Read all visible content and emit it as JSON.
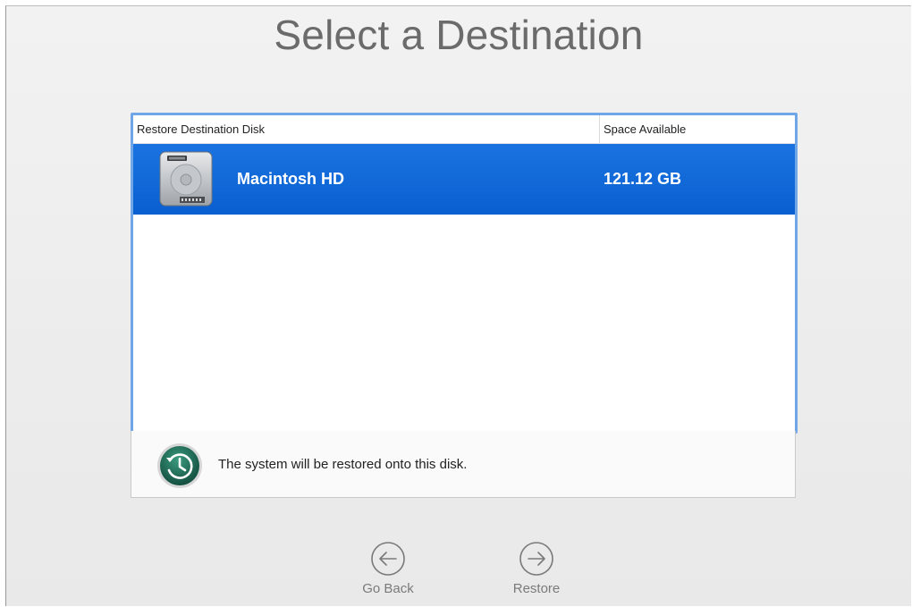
{
  "title": "Select a Destination",
  "table": {
    "columns": [
      "Restore Destination Disk",
      "Space Available"
    ],
    "rows": [
      {
        "name": "Macintosh HD",
        "space": "121.12 GB",
        "icon": "hard-disk-icon",
        "selected": true
      }
    ]
  },
  "info": {
    "icon": "time-machine-icon",
    "message": "The system will be restored onto this disk."
  },
  "buttons": {
    "back": {
      "label": "Go Back",
      "icon": "arrow-left-circle-icon"
    },
    "restore": {
      "label": "Restore",
      "icon": "arrow-right-circle-icon"
    }
  },
  "colors": {
    "selection": "#1a73e0",
    "focus_ring": "#6fa6e8",
    "title_text": "#6b6b6b",
    "time_machine": "#1f6f5a"
  }
}
